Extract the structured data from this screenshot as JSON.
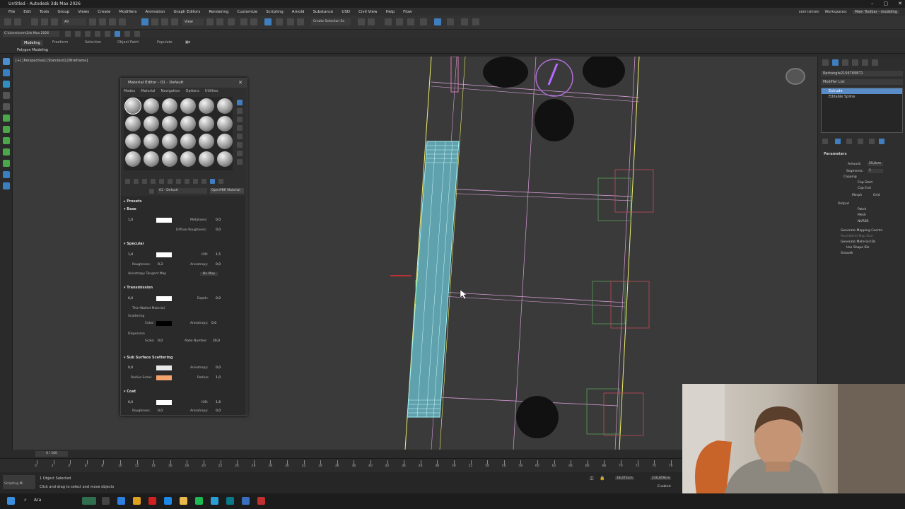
{
  "window": {
    "title": "Untitled - Autodesk 3ds Max 2026"
  },
  "menu": [
    "File",
    "Edit",
    "Tools",
    "Group",
    "Views",
    "Create",
    "Modifiers",
    "Animation",
    "Graph Editors",
    "Rendering",
    "Customize",
    "Scripting",
    "Arnold",
    "Substance",
    "USD",
    "Civil View",
    "Help",
    "Flow"
  ],
  "menu_right": {
    "user": "cem isimen",
    "workspaces_label": "Workspaces:",
    "workspace": "Main Toolbar - modeling"
  },
  "toolbar": {
    "selection_filter": "All",
    "view_mode": "View",
    "create_selection_set": "Create Selection Se"
  },
  "path_field": "C:\\Users\\cem\\3ds Max 2026",
  "ribbon": {
    "tabs": [
      "Modeling",
      "Freeform",
      "Selection",
      "Object Paint",
      "Populate"
    ],
    "sub": "Polygon Modeling"
  },
  "viewport": {
    "label": "[+] [Perspective] [Standard] [Wireframe]"
  },
  "command_panel": {
    "object_name": "Rectangle2106769871",
    "modifier_list": "Modifier List",
    "stack": [
      "Extrude",
      "Editable Spline"
    ],
    "parameters_title": "Parameters",
    "amount_label": "Amount:",
    "amount": "25,0cm",
    "segments_label": "Segments:",
    "segments": "1",
    "capping": "Capping",
    "cap_start": "Cap Start",
    "cap_end": "Cap End",
    "morph": "Morph",
    "grid": "Grid",
    "output": "Output",
    "patch": "Patch",
    "mesh": "Mesh",
    "nurbs": "NURBS",
    "gen_mapping": "Generate Mapping Coords.",
    "real_world": "Real-World Map Size",
    "gen_mat_ids": "Generate Material IDs",
    "use_shape_ids": "Use Shape IDs",
    "smooth": "Smooth"
  },
  "material_editor": {
    "title": "Material Editor - 01 - Default",
    "menu": [
      "Modes",
      "Material",
      "Navigation",
      "Options",
      "Utilities"
    ],
    "mat_name": "01 - Default",
    "mat_type": "OpenPBR Material",
    "presets": "Presets",
    "base": {
      "title": "Base",
      "weight": "1,0",
      "metalness_label": "Metalness:",
      "metalness": "0,0",
      "diffuse_roughness_label": "Diffuse Roughness:",
      "diffuse_roughness": "0,0"
    },
    "specular": {
      "title": "Specular",
      "weight": "1,0",
      "ior_label": "IOR:",
      "ior": "1,5",
      "roughness_label": "Roughness:",
      "roughness": "0,3",
      "anisotropy_label": "Anisotropy:",
      "anisotropy": "0,0",
      "tangent_label": "Anisotropy Tangent Map",
      "no_map": "No Map"
    },
    "transmission": {
      "title": "Transmission",
      "weight": "0,0",
      "depth_label": "Depth:",
      "depth": "0,0",
      "thin": "Thin-Walled Material",
      "scattering": "Scattering",
      "color_label": "Color:",
      "aniso_label": "Anisotropy:",
      "aniso": "0,0",
      "dispersion": "Dispersion",
      "scale_label": "Scale:",
      "scale": "0,0",
      "abbe_label": "Abbe Number:",
      "abbe": "20,0"
    },
    "sss": {
      "title": "Sub Surface Scattering",
      "weight": "0,0",
      "aniso_label": "Anisotropy:",
      "aniso": "0,0",
      "radius_scale_label": "Radius Scale:",
      "radius_label": "Radius:",
      "radius": "1,0"
    },
    "coat": {
      "title": "Coat",
      "weight": "0,0",
      "ior_label": "IOR:",
      "ior": "1,6",
      "roughness_label": "Roughness:",
      "roughness": "0,0",
      "aniso_label": "Anisotropy:",
      "aniso": "0,0"
    }
  },
  "timeline": {
    "frame": "0 / 100",
    "ticks": [
      "0",
      "2",
      "4",
      "6",
      "8",
      "10",
      "12",
      "14",
      "16",
      "18",
      "20",
      "22",
      "24",
      "26",
      "28",
      "30",
      "32",
      "34",
      "36",
      "38",
      "40",
      "42",
      "44",
      "46",
      "48",
      "50",
      "52",
      "54",
      "56",
      "58",
      "60",
      "62",
      "64",
      "66",
      "68",
      "70",
      "72",
      "74",
      "76"
    ]
  },
  "status": {
    "selected": "1 Object Selected",
    "hint": "Click and drag to select and move objects",
    "scripting": "Scripting Mi",
    "enabled": "Enabled:",
    "x": "18,473cm",
    "y": "230,859cm"
  },
  "taskbar": {
    "search": "Ara"
  },
  "colors": {
    "accent": "#4a8fd0",
    "selection_blue": "#5a8cc8",
    "wire_pink": "#d79bd7",
    "wire_yellow": "#f0f070",
    "wire_cyan": "#7fe0e8",
    "sss_color": "#f4a36d"
  }
}
